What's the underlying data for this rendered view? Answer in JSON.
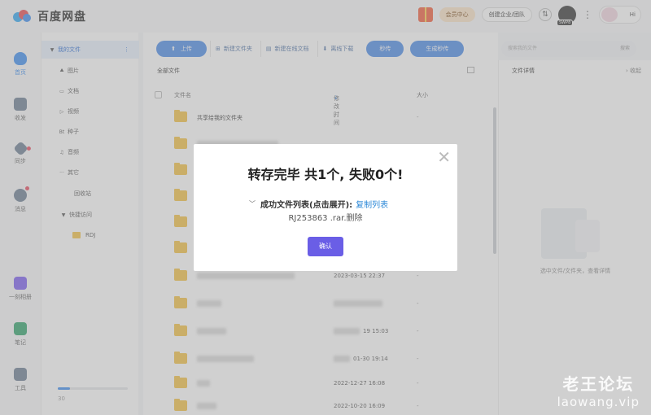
{
  "app": {
    "name": "百度网盘"
  },
  "header": {
    "vip_label": "会员中心",
    "enterprise_label": "创建企业/团队",
    "avatar_badge": "SWP8",
    "greeting": "Hi"
  },
  "rail": [
    {
      "label": "首页",
      "icon": "home-cloud-icon",
      "active": true
    },
    {
      "label": "收发",
      "icon": "inbox-icon"
    },
    {
      "label": "同步",
      "icon": "sync-icon"
    },
    {
      "label": "消息",
      "icon": "people-icon"
    },
    {
      "label": "一刻相册",
      "icon": "album-icon"
    },
    {
      "label": "笔记",
      "icon": "note-icon"
    },
    {
      "label": "工具",
      "icon": "grid-tools-icon"
    }
  ],
  "sidebar": {
    "my_files": "我的文件",
    "items": [
      "图片",
      "文档",
      "视频",
      "种子",
      "音频",
      "其它"
    ],
    "recycle": "回收站",
    "quick_access": "快捷访问",
    "quick_items": [
      "RDJ"
    ],
    "storage_text": "30"
  },
  "toolbar": {
    "upload": "上传",
    "new_folder": "新建文件夹",
    "new_online_doc": "新建在线文档",
    "offline_download": "离线下载",
    "instant": "秒传",
    "gen_instant": "生成秒传",
    "search_placeholder": "搜索我的文件",
    "search_button": "搜索"
  },
  "list": {
    "breadcrumb": "全部文件",
    "columns": {
      "name": "文件名",
      "modified": "修改时间",
      "size": "大小"
    },
    "rows": [
      {
        "name": "共享给我的文件夹",
        "time": "-",
        "size": "-"
      },
      {
        "name": "",
        "time": "",
        "size": ""
      },
      {
        "name": "",
        "time": "",
        "size": ""
      },
      {
        "name": "",
        "time": "",
        "size": ""
      },
      {
        "name": "",
        "time": "",
        "size": ""
      },
      {
        "name": "",
        "time": "",
        "size": ""
      },
      {
        "name": "",
        "time": "",
        "size": ""
      },
      {
        "name": "",
        "time": "2023-03-15 22:37",
        "size": "-"
      },
      {
        "name": "",
        "time": "",
        "size": "-"
      },
      {
        "name": "",
        "time": "19 15:03",
        "size": "-"
      },
      {
        "name": "",
        "time": "01-30 19:14",
        "size": "-"
      },
      {
        "name": "",
        "time": "2022-12-27 16:08",
        "size": "-"
      },
      {
        "name": "",
        "time": "2022-10-20 16:09",
        "size": "-"
      }
    ]
  },
  "detail": {
    "title": "文件详情",
    "collapse": "收起",
    "hint": "选中文件/文件夹，查看详情"
  },
  "modal": {
    "title": "转存完毕 共1个, 失败0个!",
    "list_label": "成功文件列表(点击展开):",
    "copy_link": "复制列表",
    "file_line": "RJ253863 .rar.删除",
    "ok": "确认"
  },
  "watermark": {
    "cn": "老王论坛",
    "en": "laowang.vip"
  },
  "colors": {
    "accent": "#4a8ae8",
    "modal_button": "#6a5ee6",
    "folder": "#f4c243"
  }
}
